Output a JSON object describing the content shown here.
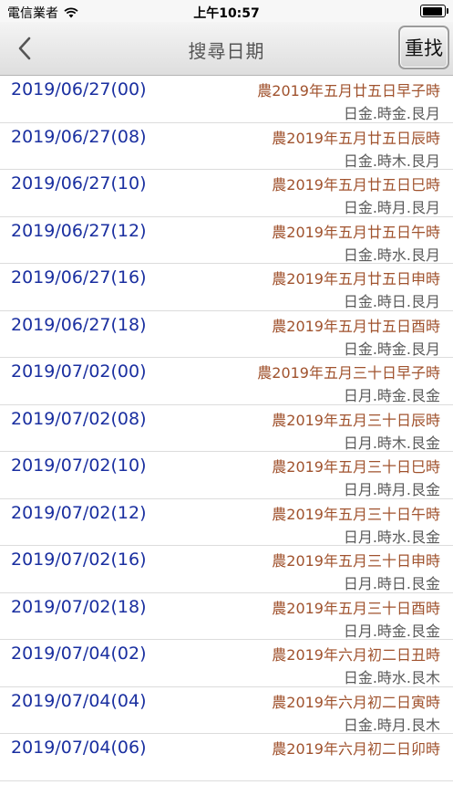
{
  "status_bar": {
    "carrier": "電信業者",
    "time": "上午10:57",
    "battery_level": 0.95
  },
  "nav": {
    "title": "搜尋日期",
    "reset_label": "重找"
  },
  "rows": [
    {
      "date": "2019/06/27(00)",
      "lunar": "農2019年五月廿五日早子時",
      "elements": "日金.時金.艮月"
    },
    {
      "date": "2019/06/27(08)",
      "lunar": "農2019年五月廿五日辰時",
      "elements": "日金.時木.艮月"
    },
    {
      "date": "2019/06/27(10)",
      "lunar": "農2019年五月廿五日巳時",
      "elements": "日金.時月.艮月"
    },
    {
      "date": "2019/06/27(12)",
      "lunar": "農2019年五月廿五日午時",
      "elements": "日金.時水.艮月"
    },
    {
      "date": "2019/06/27(16)",
      "lunar": "農2019年五月廿五日申時",
      "elements": "日金.時日.艮月"
    },
    {
      "date": "2019/06/27(18)",
      "lunar": "農2019年五月廿五日酉時",
      "elements": "日金.時金.艮月"
    },
    {
      "date": "2019/07/02(00)",
      "lunar": "農2019年五月三十日早子時",
      "elements": "日月.時金.艮金"
    },
    {
      "date": "2019/07/02(08)",
      "lunar": "農2019年五月三十日辰時",
      "elements": "日月.時木.艮金"
    },
    {
      "date": "2019/07/02(10)",
      "lunar": "農2019年五月三十日巳時",
      "elements": "日月.時月.艮金"
    },
    {
      "date": "2019/07/02(12)",
      "lunar": "農2019年五月三十日午時",
      "elements": "日月.時水.艮金"
    },
    {
      "date": "2019/07/02(16)",
      "lunar": "農2019年五月三十日申時",
      "elements": "日月.時日.艮金"
    },
    {
      "date": "2019/07/02(18)",
      "lunar": "農2019年五月三十日酉時",
      "elements": "日月.時金.艮金"
    },
    {
      "date": "2019/07/04(02)",
      "lunar": "農2019年六月初二日丑時",
      "elements": "日金.時水.艮木"
    },
    {
      "date": "2019/07/04(04)",
      "lunar": "農2019年六月初二日寅時",
      "elements": "日金.時月.艮木"
    },
    {
      "date": "2019/07/04(06)",
      "lunar": "農2019年六月初二日卯時",
      "elements": ""
    }
  ]
}
